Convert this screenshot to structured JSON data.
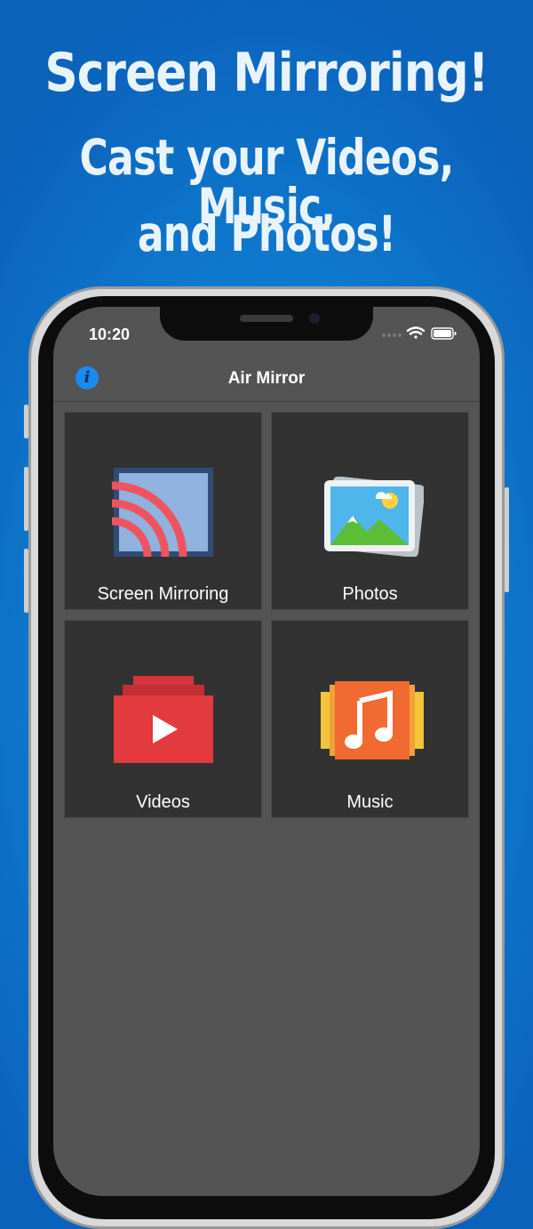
{
  "promo": {
    "line1": "Screen Mirroring!",
    "line2": "Cast your Videos, Music,",
    "line3": "and Photos!"
  },
  "status_bar": {
    "time": "10:20",
    "icons": [
      "signal-dots-icon",
      "wifi-icon",
      "battery-icon"
    ]
  },
  "navbar": {
    "title": "Air Mirror",
    "info_icon": "info-icon",
    "info_glyph": "i"
  },
  "tiles": [
    {
      "label": "Screen Mirroring",
      "icon": "screen-mirroring-icon"
    },
    {
      "label": "Photos",
      "icon": "photos-icon"
    },
    {
      "label": "Videos",
      "icon": "videos-icon"
    },
    {
      "label": "Music",
      "icon": "music-icon"
    }
  ],
  "colors": {
    "background": "#0f80d4",
    "screen": "#545454",
    "tile": "#323232",
    "accent_blue": "#1a8cf0"
  }
}
